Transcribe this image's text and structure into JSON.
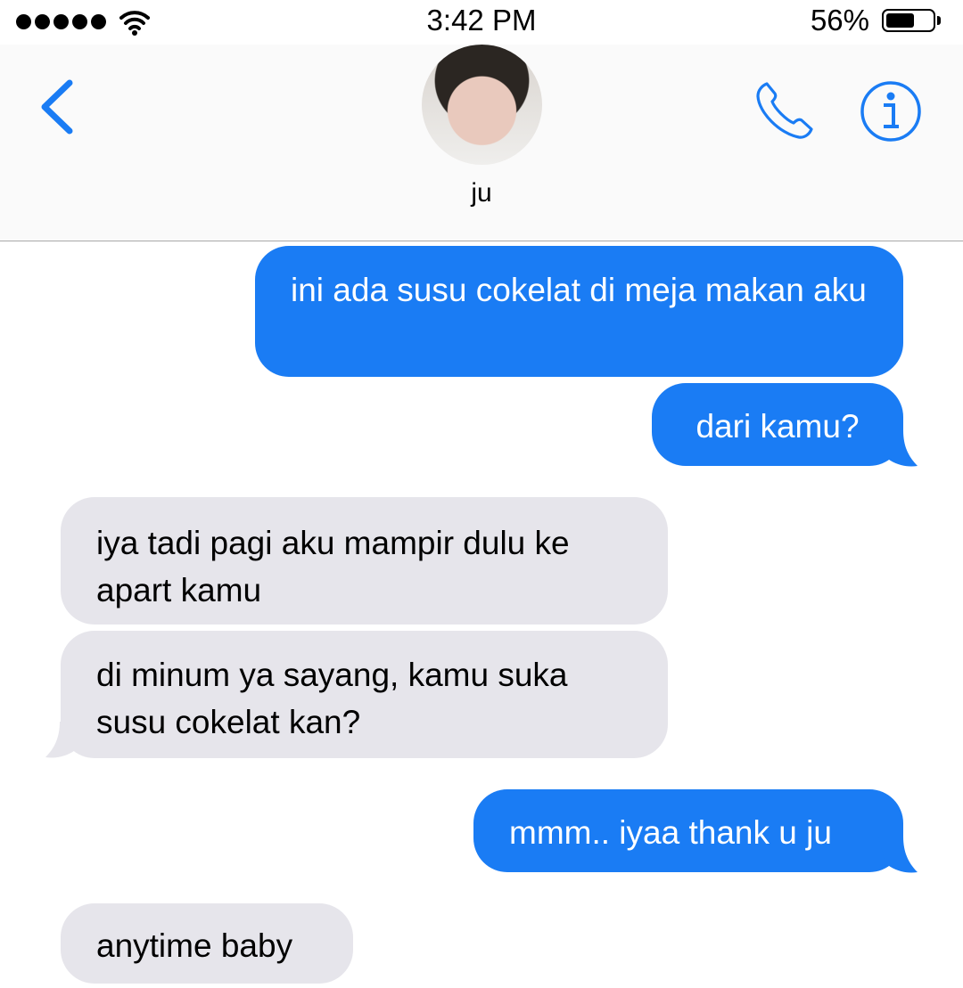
{
  "status_bar": {
    "time": "3:42 PM",
    "battery_percent": "56%",
    "battery_level": 0.56,
    "signal_icon": "signal-dots-icon",
    "wifi_icon": "wifi-icon"
  },
  "header": {
    "contact_name": "ju",
    "back_icon": "chevron-left-icon",
    "call_icon": "phone-icon",
    "info_icon": "info-icon"
  },
  "colors": {
    "accent": "#1a7cf4",
    "sent_bubble": "#1a7cf4",
    "received_bubble": "#e6e5eb"
  },
  "messages": [
    {
      "direction": "sent",
      "text": "ini ada susu cokelat di meja makan aku"
    },
    {
      "direction": "sent",
      "text": "dari kamu?"
    },
    {
      "direction": "received",
      "text": "iya tadi pagi aku mampir dulu ke apart kamu"
    },
    {
      "direction": "received",
      "text": "di minum ya sayang, kamu suka susu cokelat kan?"
    },
    {
      "direction": "sent",
      "text": "mmm.. iyaa thank u ju"
    },
    {
      "direction": "received",
      "text": "anytime baby"
    }
  ]
}
